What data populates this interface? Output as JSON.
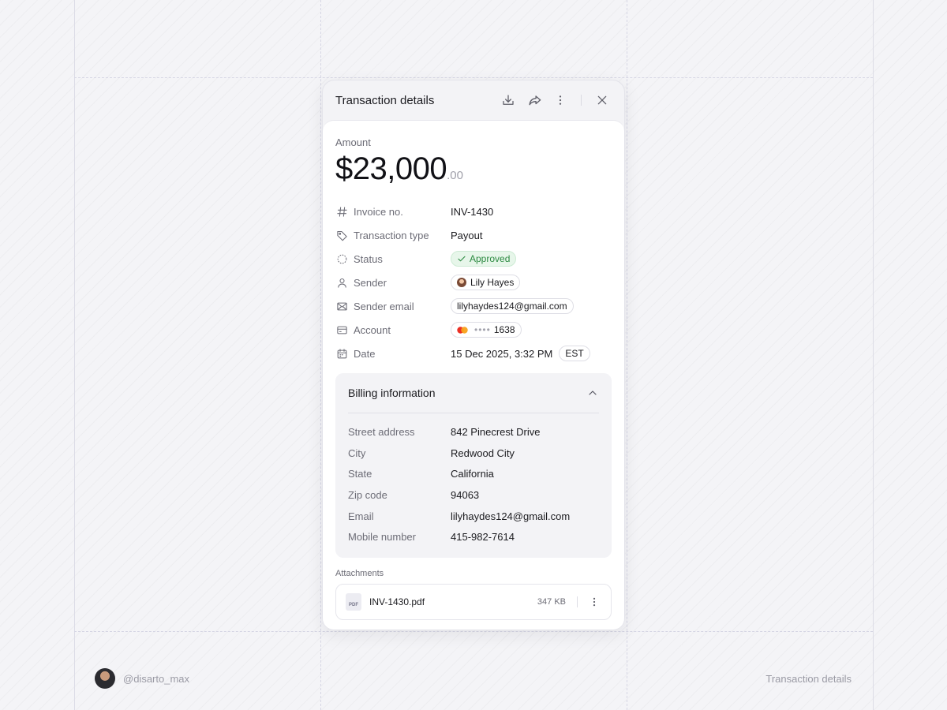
{
  "panel": {
    "title": "Transaction details",
    "actions": {
      "download_icon": "download-icon",
      "share_icon": "share-icon",
      "more_icon": "more-vertical-icon",
      "close_icon": "close-icon"
    }
  },
  "amount": {
    "label": "Amount",
    "whole": "$23,000",
    "cents": ".00"
  },
  "details": {
    "invoice": {
      "label": "Invoice no.",
      "value": "INV-1430"
    },
    "type": {
      "label": "Transaction type",
      "value": "Payout"
    },
    "status": {
      "label": "Status",
      "value": "Approved",
      "color": "#2c8a41"
    },
    "sender": {
      "label": "Sender",
      "value": "Lily Hayes"
    },
    "sender_email": {
      "label": "Sender email",
      "value": "lilyhaydes124@gmail.com"
    },
    "account": {
      "label": "Account",
      "masked": "••••",
      "last4": "1638"
    },
    "date": {
      "label": "Date",
      "value": "15 Dec 2025, 3:32 PM",
      "timezone": "EST"
    }
  },
  "billing": {
    "title": "Billing information",
    "rows": [
      {
        "label": "Street address",
        "value": "842 Pinecrest Drive"
      },
      {
        "label": "City",
        "value": "Redwood City"
      },
      {
        "label": "State",
        "value": "California"
      },
      {
        "label": "Zip code",
        "value": "94063"
      },
      {
        "label": "Email",
        "value": "lilyhaydes124@gmail.com"
      },
      {
        "label": "Mobile number",
        "value": "415-982-7614"
      }
    ]
  },
  "attachments": {
    "label": "Attachments",
    "items": [
      {
        "icon_text": "PDF",
        "name": "INV-1430.pdf",
        "size": "347 KB"
      }
    ]
  },
  "footer": {
    "handle": "@disarto_max",
    "caption": "Transaction details"
  }
}
